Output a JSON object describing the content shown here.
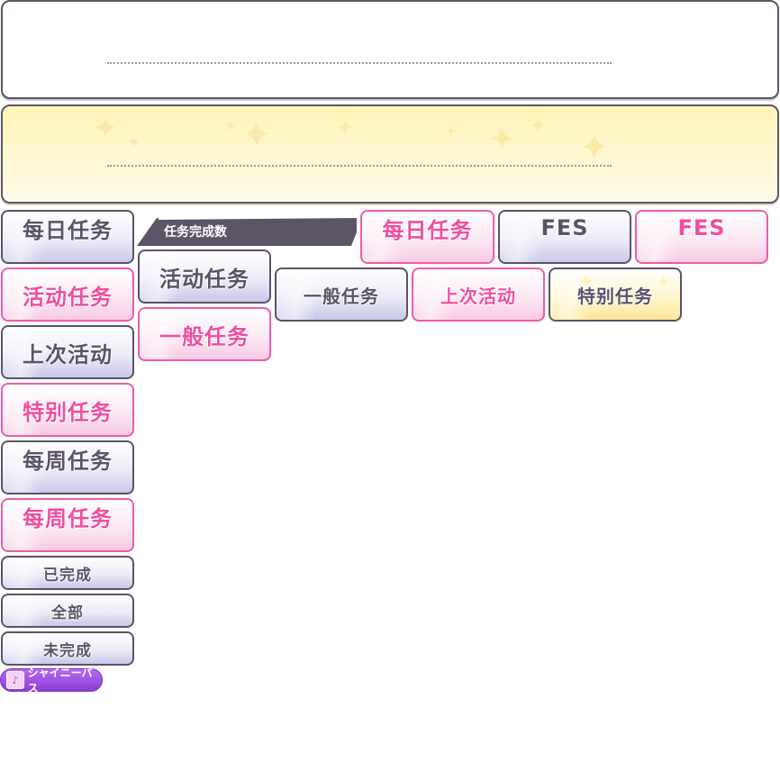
{
  "header": {
    "white_panel_text": "",
    "yellow_panel_text": ""
  },
  "left_column": [
    {
      "label": "每日任务",
      "style": "dark"
    },
    {
      "label": "活动任务",
      "style": "pink"
    },
    {
      "label": "上次活动",
      "style": "dark"
    },
    {
      "label": "特别任务",
      "style": "pink"
    },
    {
      "label": "每周任务",
      "style": "dark"
    },
    {
      "label": "每周任务",
      "style": "pink"
    }
  ],
  "filters": [
    {
      "label": "已完成"
    },
    {
      "label": "全部"
    },
    {
      "label": "未完成"
    }
  ],
  "completion_banner": {
    "label": "任务完成数"
  },
  "middle_column": [
    {
      "label": "活动任务",
      "style": "dark"
    },
    {
      "label": "一般任务",
      "style": "pink"
    }
  ],
  "top_row": [
    {
      "label": "每日任务",
      "style": "pink"
    },
    {
      "label": "FES",
      "style": "dark"
    },
    {
      "label": "FES",
      "style": "pink"
    }
  ],
  "second_row": [
    {
      "label": "一般任务",
      "style": "dark"
    },
    {
      "label": "上次活动",
      "style": "pink"
    },
    {
      "label": "特别任务",
      "style": "gold"
    }
  ],
  "pass_badge": {
    "label": "シャイニーパス"
  },
  "colors": {
    "dark_border": "#5b5367",
    "pink_border": "#f25aa8",
    "pink_text": "#f04d9f",
    "gold_fill": "#fde79a",
    "banner": "#5d5567",
    "pass_purple": "#8a3fd6"
  }
}
